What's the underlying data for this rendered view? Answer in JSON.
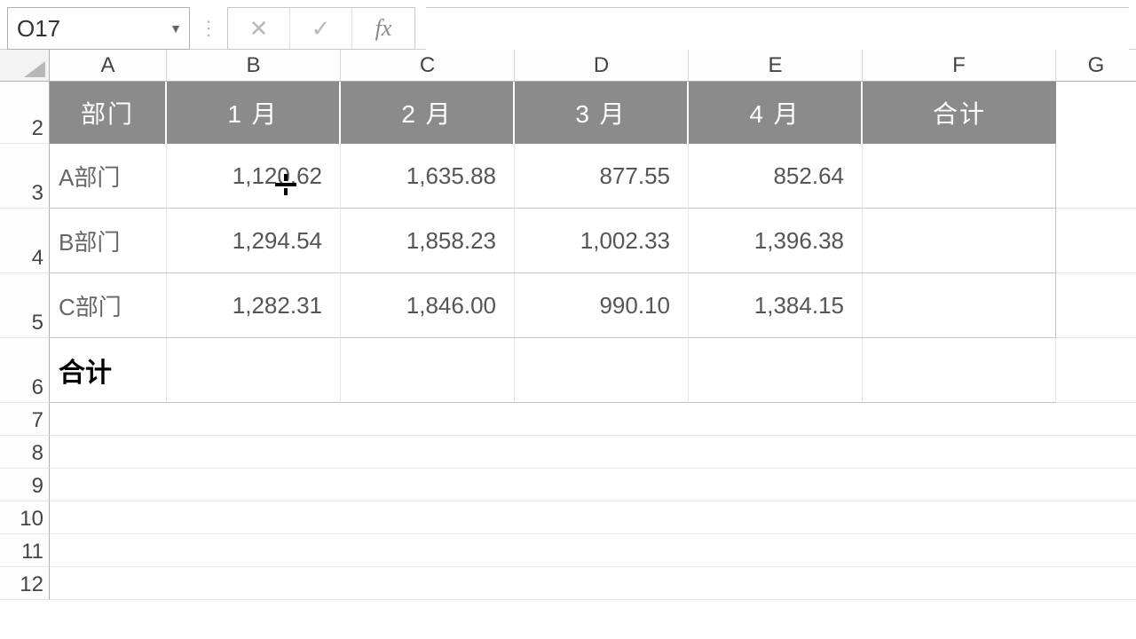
{
  "name_box": {
    "value": "O17"
  },
  "fx_buttons": {
    "cancel": "✕",
    "enter": "✓",
    "fx": "fx"
  },
  "formula_input": {
    "value": ""
  },
  "columns": [
    "A",
    "B",
    "C",
    "D",
    "E",
    "F",
    "G"
  ],
  "row_numbers": [
    2,
    3,
    4,
    5,
    6,
    7,
    8,
    9,
    10,
    11,
    12
  ],
  "table": {
    "headers": [
      "部门",
      "1 月",
      "2 月",
      "3 月",
      "4 月",
      "合计"
    ],
    "rows": [
      {
        "dept": "A部门",
        "m1": "1,120.62",
        "m2": "1,635.88",
        "m3": "877.55",
        "m4": "852.64",
        "total": ""
      },
      {
        "dept": "B部门",
        "m1": "1,294.54",
        "m2": "1,858.23",
        "m3": "1,002.33",
        "m4": "1,396.38",
        "total": ""
      },
      {
        "dept": "C部门",
        "m1": "1,282.31",
        "m2": "1,846.00",
        "m3": "990.10",
        "m4": "1,384.15",
        "total": ""
      }
    ],
    "total_label": "合计"
  },
  "chart_data": {
    "type": "table",
    "title": "",
    "columns": [
      "部门",
      "1 月",
      "2 月",
      "3 月",
      "4 月",
      "合计"
    ],
    "rows": [
      [
        "A部门",
        1120.62,
        1635.88,
        877.55,
        852.64,
        null
      ],
      [
        "B部门",
        1294.54,
        1858.23,
        1002.33,
        1396.38,
        null
      ],
      [
        "C部门",
        1282.31,
        1846.0,
        990.1,
        1384.15,
        null
      ],
      [
        "合计",
        null,
        null,
        null,
        null,
        null
      ]
    ]
  }
}
